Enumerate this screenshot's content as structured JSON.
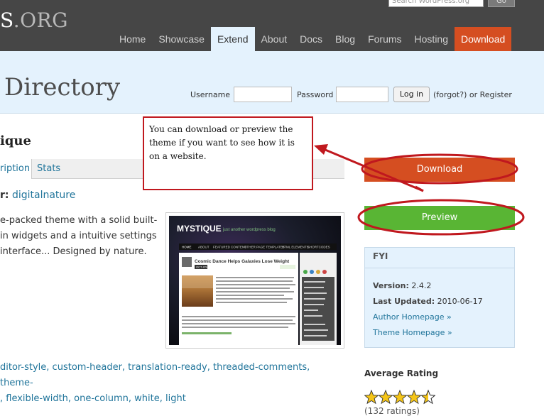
{
  "header": {
    "logo_suffix": ".ORG",
    "logo_partial": "S",
    "search_placeholder": "Search WordPress.org",
    "go_label": "Go",
    "nav": [
      {
        "label": "Home"
      },
      {
        "label": "Showcase"
      },
      {
        "label": "Extend"
      },
      {
        "label": "About"
      },
      {
        "label": "Docs"
      },
      {
        "label": "Blog"
      },
      {
        "label": "Forums"
      },
      {
        "label": "Hosting"
      },
      {
        "label": "Download"
      }
    ],
    "active_nav": "Extend",
    "accent_color": "#d54e21"
  },
  "subheader": {
    "title": "Directory",
    "username_label": "Username",
    "password_label": "Password",
    "login_button": "Log in",
    "forgot_text": "(forgot?) or Register"
  },
  "theme": {
    "name": "ique",
    "tabs": [
      {
        "label": "ription"
      },
      {
        "label": "Stats"
      }
    ],
    "author_label": "r:",
    "author_name": "digitalnature",
    "description": "e-packed theme with a solid built-in widgets and a intuitive settings interface... Designed by nature.",
    "tags_line1": "ditor-style, custom-header, translation-ready, threaded-comments, theme-",
    "tags_line2": ", flexible-width, one-column, white, light"
  },
  "screenshot_preview": {
    "site_title": "MYSTIQUE",
    "tagline": "just another wordpress blog",
    "menu": [
      "HOME",
      "ABOUT",
      "FEATURED CONTENT",
      "OTHER PAGE TEMPLATES",
      "HTML ELEMENTS",
      "SHORTCODES"
    ],
    "post_title": "Cosmic Dance Helps Galaxies Lose Weight",
    "post_date": "OCT 4TH"
  },
  "sidebar": {
    "download_label": "Download",
    "preview_label": "Preview",
    "fyi_title": "FYI",
    "version_label": "Version:",
    "version_value": "2.4.2",
    "updated_label": "Last Updated:",
    "updated_value": "2010-06-17",
    "author_homepage": "Author Homepage »",
    "theme_homepage": "Theme Homepage »",
    "avg_rating_title": "Average Rating",
    "rating_stars": 4.5,
    "ratings_count": "(132 ratings)",
    "download_color": "#d54e21",
    "preview_color": "#59b534"
  },
  "annotation": {
    "callout_text": "You can download or preview the theme if you want to see how it is on a website.",
    "color": "#c0181e"
  }
}
